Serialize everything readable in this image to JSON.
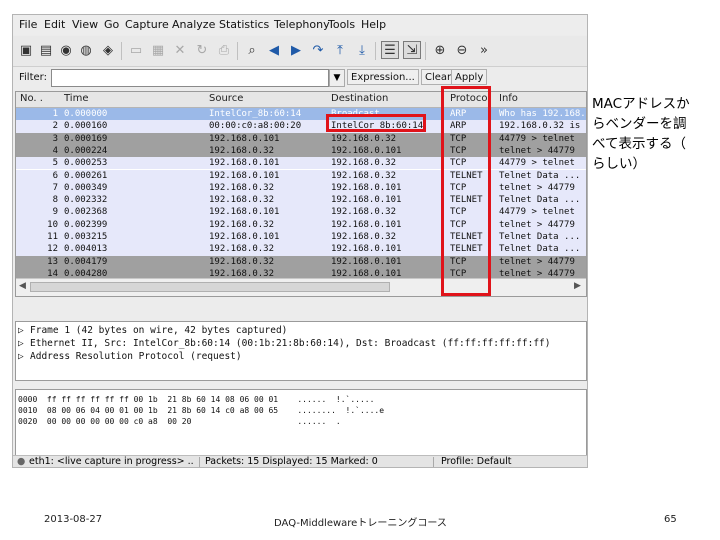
{
  "menu": [
    "File",
    "Edit",
    "View",
    "Go",
    "Capture",
    "Analyze",
    "Statistics",
    "Telephony",
    "Tools",
    "Help"
  ],
  "filter": {
    "label": "Filter:",
    "value": "",
    "expression_label": "Expression...",
    "clear_label": "Clear",
    "apply_label": "Apply"
  },
  "packet_list": {
    "columns": [
      "No. .",
      "Time",
      "Source",
      "Destination",
      "Protocol",
      "Info"
    ],
    "rows": [
      {
        "no": "1",
        "time": "0.000000",
        "source": "IntelCor_8b:60:14",
        "destination": "Broadcast",
        "protocol": "ARP",
        "info": "Who has 192.168.0.32?",
        "style": "selected"
      },
      {
        "no": "2",
        "time": "0.000160",
        "source": "00:00:c0:a8:00:20",
        "destination": "IntelCor_8b:60:14",
        "protocol": "ARP",
        "info": "192.168.0.32 is at",
        "style": "lavender"
      },
      {
        "no": "3",
        "time": "0.000169",
        "source": "192.168.0.101",
        "destination": "192.168.0.32",
        "protocol": "TCP",
        "info": "44779 > telnet",
        "style": "gray"
      },
      {
        "no": "4",
        "time": "0.000224",
        "source": "192.168.0.32",
        "destination": "192.168.0.101",
        "protocol": "TCP",
        "info": "telnet > 44779",
        "style": "gray"
      },
      {
        "no": "5",
        "time": "0.000253",
        "source": "192.168.0.101",
        "destination": "192.168.0.32",
        "protocol": "TCP",
        "info": "44779 > telnet",
        "style": "lavender"
      },
      {
        "no": "6",
        "time": "0.000261",
        "source": "192.168.0.101",
        "destination": "192.168.0.32",
        "protocol": "TELNET",
        "info": "Telnet Data ...",
        "style": "lavender"
      },
      {
        "no": "7",
        "time": "0.000349",
        "source": "192.168.0.32",
        "destination": "192.168.0.101",
        "protocol": "TCP",
        "info": "telnet > 44779",
        "style": "lavender"
      },
      {
        "no": "8",
        "time": "0.002332",
        "source": "192.168.0.32",
        "destination": "192.168.0.101",
        "protocol": "TELNET",
        "info": "Telnet Data ...",
        "style": "lavender"
      },
      {
        "no": "9",
        "time": "0.002368",
        "source": "192.168.0.101",
        "destination": "192.168.0.32",
        "protocol": "TCP",
        "info": "44779 > telnet",
        "style": "lavender"
      },
      {
        "no": "10",
        "time": "0.002399",
        "source": "192.168.0.32",
        "destination": "192.168.0.101",
        "protocol": "TCP",
        "info": "telnet > 44779",
        "style": "lavender"
      },
      {
        "no": "11",
        "time": "0.003215",
        "source": "192.168.0.101",
        "destination": "192.168.0.32",
        "protocol": "TELNET",
        "info": "Telnet Data ...",
        "style": "lavender"
      },
      {
        "no": "12",
        "time": "0.004013",
        "source": "192.168.0.32",
        "destination": "192.168.0.101",
        "protocol": "TELNET",
        "info": "Telnet Data ...",
        "style": "lavender"
      },
      {
        "no": "13",
        "time": "0.004179",
        "source": "192.168.0.32",
        "destination": "192.168.0.101",
        "protocol": "TCP",
        "info": "telnet > 44779",
        "style": "gray"
      },
      {
        "no": "14",
        "time": "0.004280",
        "source": "192.168.0.32",
        "destination": "192.168.0.101",
        "protocol": "TCP",
        "info": "telnet > 44779",
        "style": "gray"
      },
      {
        "no": "15",
        "time": "0.004298",
        "source": "192.168.0.101",
        "destination": "192.168.0.32",
        "protocol": "TCP",
        "info": "44779 > telnet",
        "style": "lavender"
      }
    ]
  },
  "details": [
    "Frame 1 (42 bytes on wire, 42 bytes captured)",
    "Ethernet II, Src: IntelCor_8b:60:14 (00:1b:21:8b:60:14), Dst: Broadcast (ff:ff:ff:ff:ff:ff)",
    "Address Resolution Protocol (request)"
  ],
  "bytes": [
    {
      "offset": "0000",
      "hex": "ff ff ff ff ff ff 00 1b  21 8b 60 14 08 06 00 01",
      "ascii": "......  !.`....."
    },
    {
      "offset": "0010",
      "hex": "08 00 06 04 00 01 00 1b  21 8b 60 14 c0 a8 00 65",
      "ascii": "........  !.`....e"
    },
    {
      "offset": "0020",
      "hex": "00 00 00 00 00 00 c0 a8  00 20",
      "ascii": "......  . "
    }
  ],
  "status": {
    "capture": "eth1: <live capture in progress> ..",
    "packets": "Packets: 15 Displayed: 15 Marked: 0",
    "profile": "Profile: Default"
  },
  "annotation": {
    "lines": [
      "MACアドレスか",
      "らベンダーを調",
      "べて表示する（",
      "らしい）"
    ]
  },
  "footer": {
    "date": "2013-08-27",
    "title": "DAQ-Middlewareトレーニングコース",
    "page": "65"
  },
  "colors": {
    "selected_row": "#9bb9e8",
    "lavender_row": "#e6e8fa",
    "gray_row": "#a0a0a0",
    "highlight_border": "#e0131a"
  }
}
